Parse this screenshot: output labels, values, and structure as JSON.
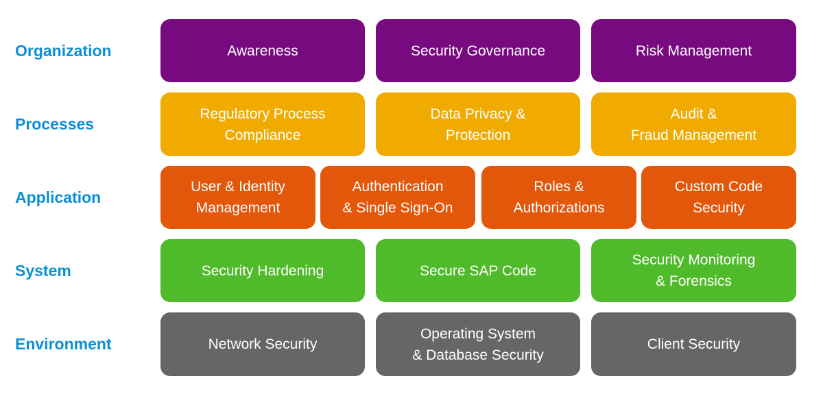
{
  "colors": {
    "label": "#0a8fd6",
    "organization": "#780a80",
    "processes": "#f0aa00",
    "application": "#e2570a",
    "system": "#4fba2a",
    "environment": "#666666"
  },
  "layers": [
    {
      "label": "Organization",
      "items": [
        "Awareness",
        "Security Governance",
        "Risk Management"
      ]
    },
    {
      "label": "Processes",
      "items": [
        "Regulatory Process\nCompliance",
        "Data Privacy &\nProtection",
        "Audit &\nFraud Management"
      ]
    },
    {
      "label": "Application",
      "items": [
        "User & Identity\nManagement",
        "Authentication\n& Single Sign-On",
        "Roles &\nAuthorizations",
        "Custom Code\nSecurity"
      ]
    },
    {
      "label": "System",
      "items": [
        "Security Hardening",
        "Secure SAP Code",
        "Security Monitoring\n& Forensics"
      ]
    },
    {
      "label": "Environment",
      "items": [
        "Network Security",
        "Operating System\n& Database Security",
        "Client Security"
      ]
    }
  ]
}
